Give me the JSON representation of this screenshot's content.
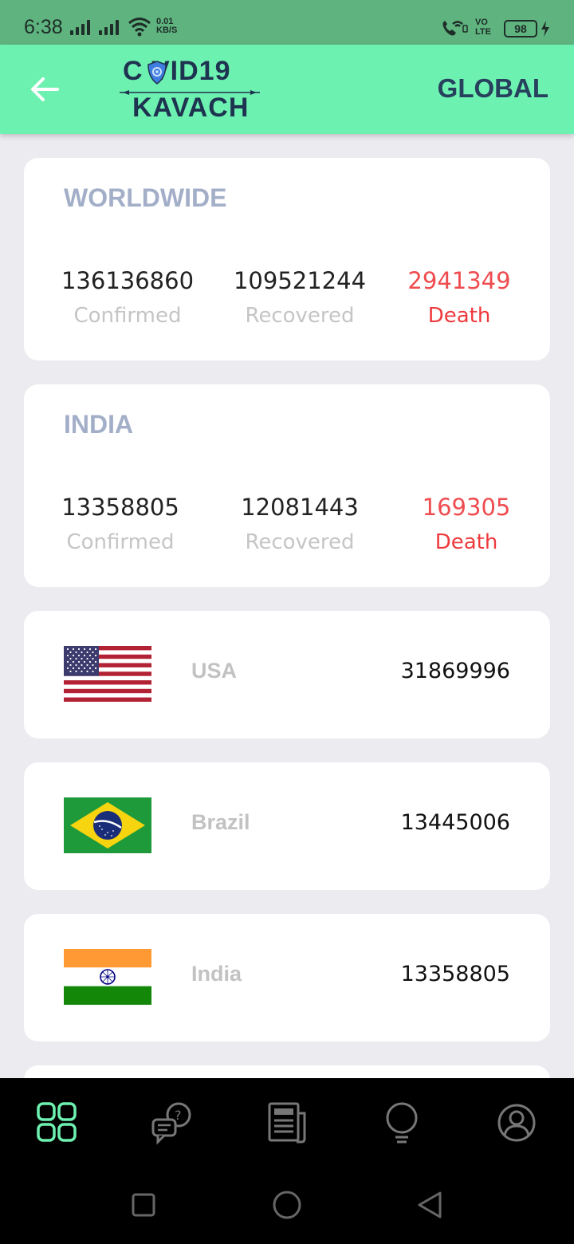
{
  "status_bar": {
    "time": "6:38",
    "speed_value": "0.01",
    "speed_unit": "KB/S",
    "volte_top": "VO",
    "volte_bottom": "LTE",
    "battery": "98"
  },
  "app_bar": {
    "logo_line1": "C  VID19",
    "logo_line2": "KAVACH",
    "global_label": "GLOBAL"
  },
  "worldwide": {
    "title": "WORLDWIDE",
    "confirmed": "136136860",
    "confirmed_label": "Confirmed",
    "recovered": "109521244",
    "recovered_label": "Recovered",
    "death": "2941349",
    "death_label": "Death"
  },
  "india_summary": {
    "title": "INDIA",
    "confirmed": "13358805",
    "confirmed_label": "Confirmed",
    "recovered": "12081443",
    "recovered_label": "Recovered",
    "death": "169305",
    "death_label": "Death"
  },
  "countries": [
    {
      "name": "USA",
      "count": "31869996"
    },
    {
      "name": "Brazil",
      "count": "13445006"
    },
    {
      "name": "India",
      "count": "13358805"
    }
  ],
  "colors": {
    "app_bar": "#6df1b0",
    "status_bar": "#5fb37f",
    "death": "#ef4c4f",
    "nav_active": "#6df1b0"
  },
  "bottom_nav": {
    "items": [
      "dashboard-icon",
      "faq-chat-icon",
      "news-icon",
      "tips-bulb-icon",
      "profile-icon"
    ]
  }
}
